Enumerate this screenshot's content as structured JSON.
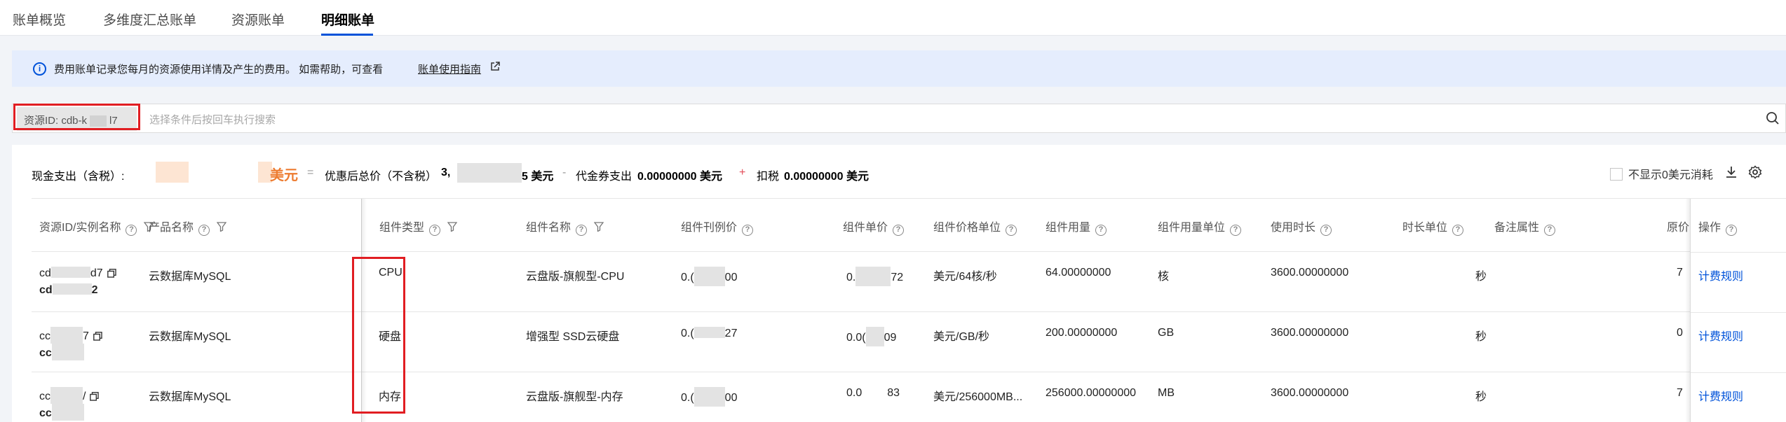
{
  "tabs": [
    {
      "label": "账单概览"
    },
    {
      "label": "多维度汇总账单"
    },
    {
      "label": "资源账单"
    },
    {
      "label": "明细账单"
    }
  ],
  "notice": {
    "text": "费用账单记录您每月的资源使用详情及产生的费用。 如需帮助，可查看",
    "link": "账单使用指南"
  },
  "filter": {
    "tag_prefix": "资源ID: cdb-k",
    "tag_suffix": "l7",
    "placeholder": "选择条件后按回车执行搜索"
  },
  "summary": {
    "cash_label": "现金支出（含税）:",
    "cash_unit": "美元",
    "eq": "=",
    "discount_label": "优惠后总价（不含税）",
    "discount_value_a": "3,",
    "discount_value_b": "5 美元",
    "minus": "-",
    "voucher_label": "代金券支出",
    "voucher_value": "0.00000000 美元",
    "plus": "+",
    "tax_label": "扣税",
    "tax_value": "0.00000000 美元",
    "hide_zero_label": "不显示0美元消耗"
  },
  "table": {
    "headers": {
      "resource_id": "资源ID/实例名称",
      "product": "产品名称",
      "component_type": "组件类型",
      "component_name": "组件名称",
      "list_price": "组件刊例价",
      "unit_price": "组件单价",
      "price_unit": "组件价格单位",
      "usage": "组件用量",
      "usage_unit": "组件用量单位",
      "duration": "使用时长",
      "duration_unit": "时长单位",
      "remark": "备注属性",
      "original": "原价",
      "action": "操作"
    },
    "rows": [
      {
        "id_a": "cd",
        "id_b": "d7",
        "name_a": "cd",
        "name_b": "2",
        "product": "云数据库MySQL",
        "type": "CPU",
        "name": "云盘版-旗舰型-CPU",
        "list_a": "0.(",
        "list_b": "00",
        "unit_a": "0.",
        "unit_b": "72",
        "price_unit": "美元/64核/秒",
        "usage": "64.00000000",
        "usage_unit": "核",
        "duration": "3600.00000000",
        "duration_unit": "秒",
        "original": "7",
        "action": "计费规则"
      },
      {
        "id_a": "cc",
        "id_b": "7",
        "name_a": "cc",
        "name_b": "",
        "product": "云数据库MySQL",
        "type": "硬盘",
        "name": "增强型 SSD云硬盘",
        "list_a": "0.(",
        "list_b": "27",
        "unit_a": "0.0(",
        "unit_b": "09",
        "price_unit": "美元/GB/秒",
        "usage": "200.00000000",
        "usage_unit": "GB",
        "duration": "3600.00000000",
        "duration_unit": "秒",
        "original": "0",
        "action": "计费规则"
      },
      {
        "id_a": "cc",
        "id_b": "/",
        "name_a": "cc",
        "name_b": "",
        "product": "云数据库MySQL",
        "type": "内存",
        "name": "云盘版-旗舰型-内存",
        "list_a": "0.(",
        "list_b": "00",
        "unit_a": "0.0",
        "unit_b": "83",
        "price_unit": "美元/256000MB...",
        "usage": "256000.00000000",
        "usage_unit": "MB",
        "duration": "3600.00000000",
        "duration_unit": "秒",
        "original": "7",
        "action": "计费规则"
      }
    ]
  },
  "colors": {
    "brand": "#0052d9",
    "highlight_red": "#e11d22",
    "cost_orange": "#ed7b2f"
  }
}
